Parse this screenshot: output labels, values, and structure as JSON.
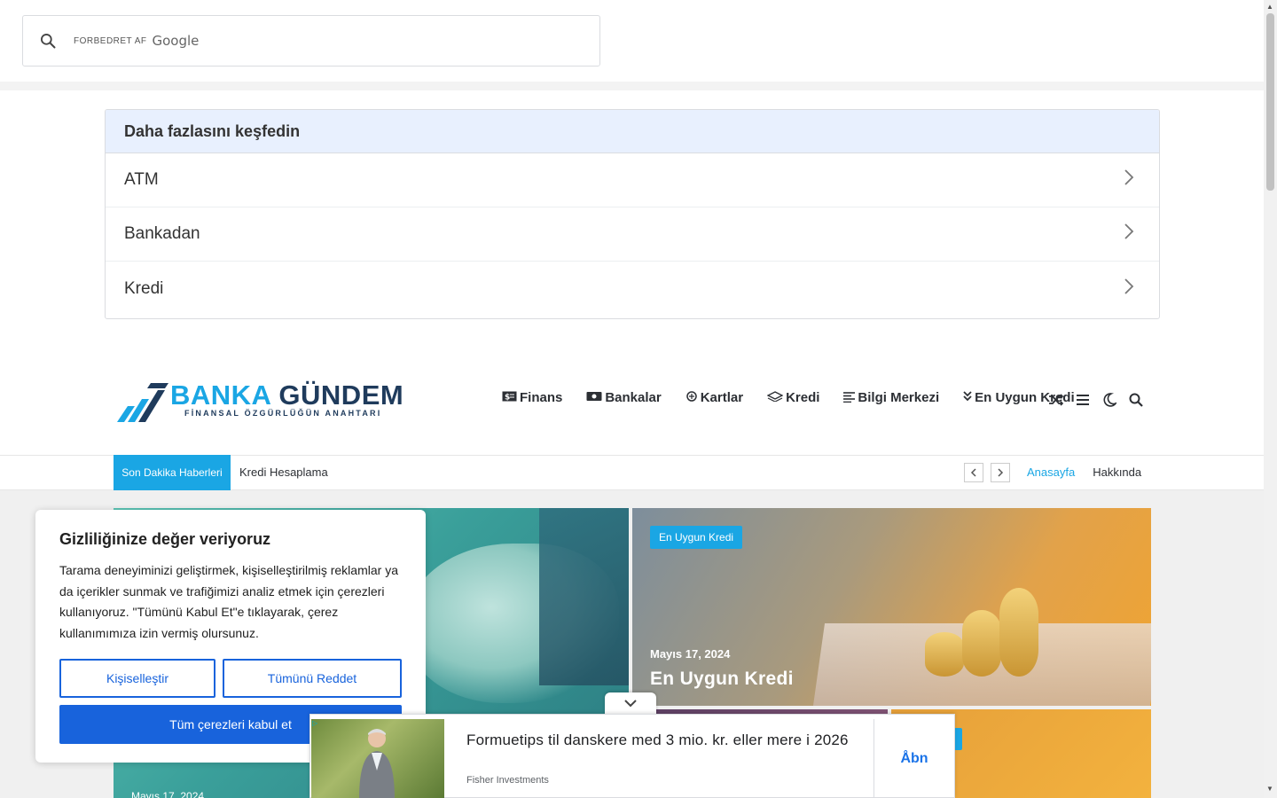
{
  "google_search": {
    "powered_by": "FORBEDRET AF",
    "brand": "Google",
    "icon": "search-icon"
  },
  "discover": {
    "title": "Daha fazlasını keşfedin",
    "items": [
      {
        "label": "ATM"
      },
      {
        "label": "Bankadan"
      },
      {
        "label": "Kredi"
      }
    ]
  },
  "site": {
    "logo_word1": "BANKA",
    "logo_word2": "GÜNDEM",
    "logo_tagline": "FİNANSAL ÖZGÜRLÜĞÜN ANAHTARI",
    "nav": [
      {
        "label": "Finans",
        "icon": "money-icon"
      },
      {
        "label": "Bankalar",
        "icon": "bank-icon"
      },
      {
        "label": "Kartlar",
        "icon": "card-icon"
      },
      {
        "label": "Kredi",
        "icon": "layers-icon"
      },
      {
        "label": "Bilgi Merkezi",
        "icon": "text-align-icon"
      },
      {
        "label": "En Uygun Kredi",
        "icon": "double-chevron-icon"
      }
    ],
    "nav_icons": [
      "shuffle-icon",
      "menu-icon",
      "moon-icon",
      "search-icon"
    ]
  },
  "topbar": {
    "breaking_label": "Son Dakika Haberleri",
    "breaking_text": "Kredi Hesaplama",
    "links": [
      {
        "label": "Anasayfa",
        "active": true
      },
      {
        "label": "Hakkında",
        "active": false
      }
    ]
  },
  "featured": {
    "big_date": "Mayıs 17, 2024",
    "right_badge": "En Uygun Kredi",
    "right_date": "Mayıs 17, 2024",
    "right_title": "En Uygun Kredi"
  },
  "cookie": {
    "title": "Gizliliğinize değer veriyoruz",
    "body": "Tarama deneyiminizi geliştirmek, kişiselleştirilmiş reklamlar ya da içerikler sunmak ve trafiğimizi analiz etmek için çerezleri kullanıyoruz. \"Tümünü Kabul Et\"e tıklayarak, çerez kullanımımıza izin vermiş olursunuz.",
    "customize": "Kişiselleştir",
    "reject": "Tümünü Reddet",
    "accept": "Tüm çerezleri kabul et"
  },
  "ad": {
    "headline": "Formuetips til danskere med 3 mio. kr. eller mere i 2026",
    "source": "Fisher Investments",
    "cta": "Åbn"
  },
  "colors": {
    "accent": "#1aa6e4",
    "cookie_blue": "#1863dc",
    "ad_blue": "#1a73e8",
    "brand_dark": "#1f3b5c"
  }
}
